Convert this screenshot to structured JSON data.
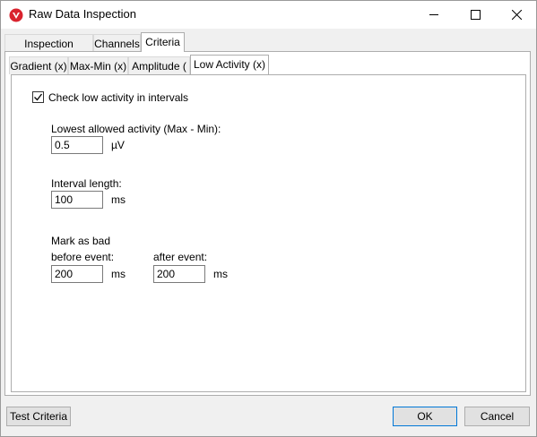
{
  "window": {
    "title": "Raw Data Inspection"
  },
  "outer_tabs": [
    {
      "label": "Inspection Method"
    },
    {
      "label": "Channels"
    },
    {
      "label": "Criteria"
    }
  ],
  "inner_tabs": [
    {
      "label": "Gradient (x)"
    },
    {
      "label": "Max-Min (x)"
    },
    {
      "label": "Amplitude ( )"
    },
    {
      "label": "Low Activity (x)"
    }
  ],
  "low_activity": {
    "checkbox_label": "Check low activity in intervals",
    "checked": true,
    "lowest_label": "Lowest allowed activity (Max - Min):",
    "lowest_value": "0.5",
    "lowest_unit": "µV",
    "interval_label": "Interval length:",
    "interval_value": "100",
    "interval_unit": "ms",
    "mark_label": "Mark as bad",
    "before_label": "before event:",
    "before_value": "200",
    "before_unit": "ms",
    "after_label": "after event:",
    "after_value": "200",
    "after_unit": "ms"
  },
  "buttons": {
    "test": "Test Criteria",
    "ok": "OK",
    "cancel": "Cancel"
  }
}
